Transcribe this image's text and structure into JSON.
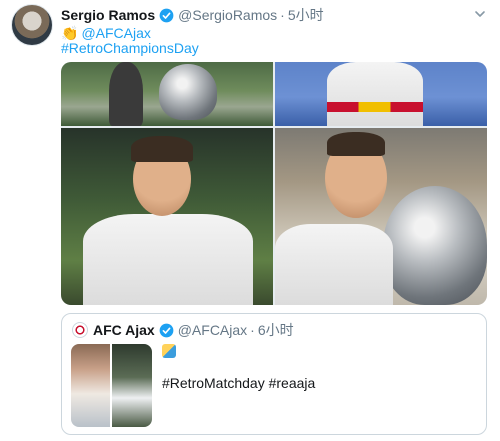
{
  "tweet": {
    "author_name": "Sergio Ramos",
    "author_handle": "@SergioRamos",
    "separator": "·",
    "time": "5小时",
    "clap_emoji": "👏",
    "mention": "@AFCAjax",
    "hashtag": "#RetroChampionsDay",
    "verified_color": "#1da1f2"
  },
  "quoted_tweet": {
    "author_name": "AFC Ajax",
    "author_handle": "@AFCAjax",
    "separator": "·",
    "time": "6小时",
    "text": "#RetroMatchday #reaaja"
  },
  "icons": {
    "verified": "verified-badge-icon",
    "menu": "chevron-down-icon"
  },
  "colors": {
    "link": "#1da1f2",
    "secondary_text": "#657786",
    "border": "#ccd6dd"
  }
}
